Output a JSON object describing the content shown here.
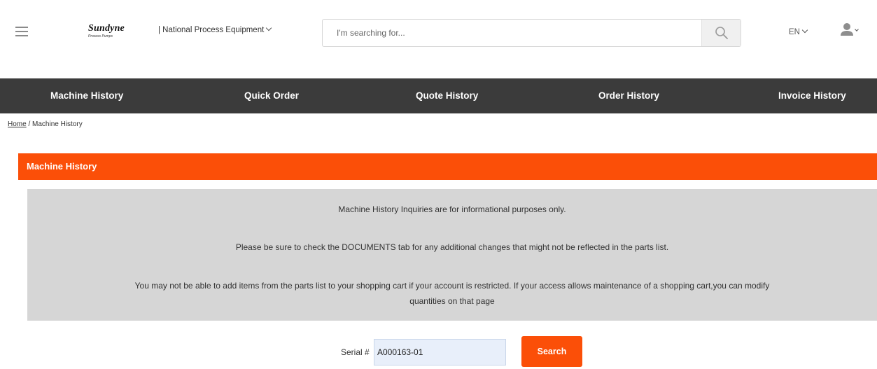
{
  "header": {
    "logo_text": "Sundyne",
    "logo_subtext": "Process Pumps",
    "company_label": "| National Process Equipment",
    "search_placeholder": "I'm searching for...",
    "language": "EN"
  },
  "nav": {
    "items": [
      {
        "label": "Machine History"
      },
      {
        "label": "Quick Order"
      },
      {
        "label": "Quote History"
      },
      {
        "label": "Order History"
      },
      {
        "label": "Invoice History"
      }
    ]
  },
  "breadcrumb": {
    "home": "Home",
    "separator": " / ",
    "current": "Machine History"
  },
  "panel": {
    "title": "Machine History",
    "info_lines": [
      "Machine History Inquiries are for informational purposes only.",
      "Please be sure to check the DOCUMENTS tab for any additional changes that might not be reflected in the parts list.",
      "You may not be able to add items from the parts list to your shopping cart if your account is restricted. If your access allows maintenance of a shopping cart,you can modify",
      "quantities on that page"
    ]
  },
  "serial_search": {
    "label": "Serial #",
    "value": "A000163-01",
    "button_label": "Search"
  },
  "colors": {
    "accent": "#fb4f08",
    "nav_background": "#3b3b3b",
    "info_background": "#d6d6d6"
  }
}
